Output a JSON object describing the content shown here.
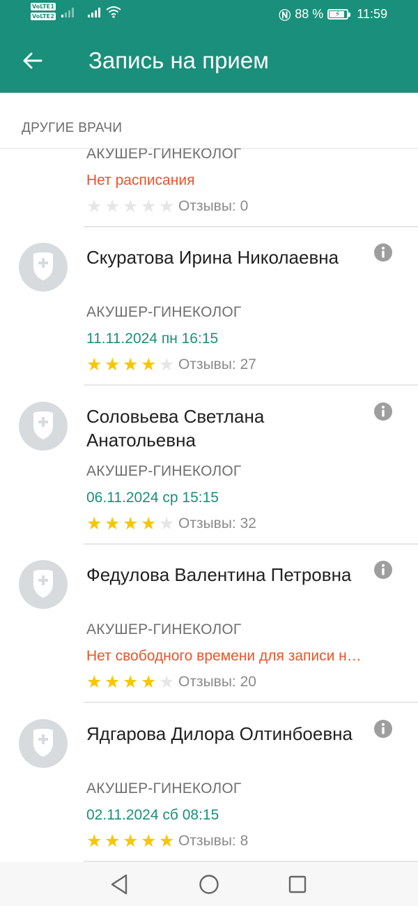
{
  "status": {
    "sim1": "1",
    "sim2": "2",
    "volte": "VoLTE",
    "battery_text": "88 %",
    "battery_level": 0.88,
    "time": "11:59"
  },
  "app_bar": {
    "title": "Запись на прием"
  },
  "section": {
    "label": "ДРУГИЕ ВРАЧИ"
  },
  "doctors": [
    {
      "name": "",
      "specialty": "АКУШЕР-ГИНЕКОЛОГ",
      "slot": "Нет расписания",
      "slot_available": false,
      "rating": 0,
      "reviews": "Отзывы: 0"
    },
    {
      "name": "Скуратова Ирина Николаевна",
      "specialty": "АКУШЕР-ГИНЕКОЛОГ",
      "slot": "11.11.2024 пн 16:15",
      "slot_available": true,
      "rating": 4,
      "reviews": "Отзывы: 27"
    },
    {
      "name": "Соловьева Светлана Анатольевна",
      "specialty": "АКУШЕР-ГИНЕКОЛОГ",
      "slot": "06.11.2024 ср 15:15",
      "slot_available": true,
      "rating": 4,
      "reviews": "Отзывы: 32"
    },
    {
      "name": "Федулова Валентина Петровна",
      "specialty": "АКУШЕР-ГИНЕКОЛОГ",
      "slot": "Нет свободного времени для записи н…",
      "slot_available": false,
      "rating": 4,
      "reviews": "Отзывы: 20"
    },
    {
      "name": "Ядгарова Дилора Олтинбоевна",
      "specialty": "АКУШЕР-ГИНЕКОЛОГ",
      "slot": "02.11.2024 сб 08:15",
      "slot_available": true,
      "rating": 5,
      "reviews": "Отзывы: 8"
    }
  ],
  "colors": {
    "primary": "#1a8f7b",
    "slot_none": "#e8552a",
    "star_on": "#f7c600",
    "star_off": "#e6e6e6"
  }
}
